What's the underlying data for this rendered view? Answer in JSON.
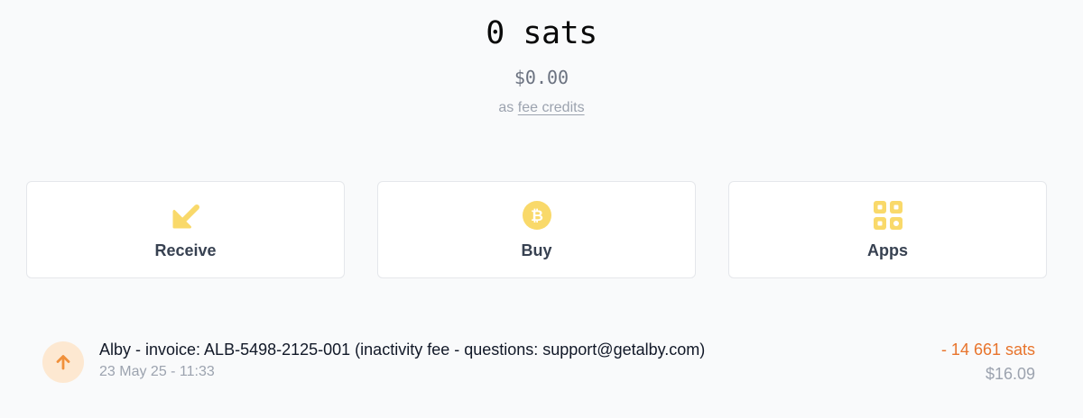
{
  "balance": {
    "amount": "0 sats",
    "fiat": "$0.00",
    "note_prefix": "as",
    "note_link": "fee credits"
  },
  "actions": [
    {
      "label": "Receive",
      "icon": "arrow-down-left-icon"
    },
    {
      "label": "Buy",
      "icon": "bitcoin-icon"
    },
    {
      "label": "Apps",
      "icon": "apps-grid-icon"
    }
  ],
  "colors": {
    "accent_yellow": "#f9d96a",
    "outgoing_orange": "#e8742c",
    "outgoing_icon_bg": "#fde8d1"
  },
  "transactions": [
    {
      "direction_icon": "arrow-up-icon",
      "title": "Alby - invoice: ALB-5498-2125-001 (inactivity fee - questions: support@getalby.com)",
      "date": "23 May 25 - 11:33",
      "amount": "- 14 661 sats",
      "fiat": "$16.09"
    }
  ]
}
